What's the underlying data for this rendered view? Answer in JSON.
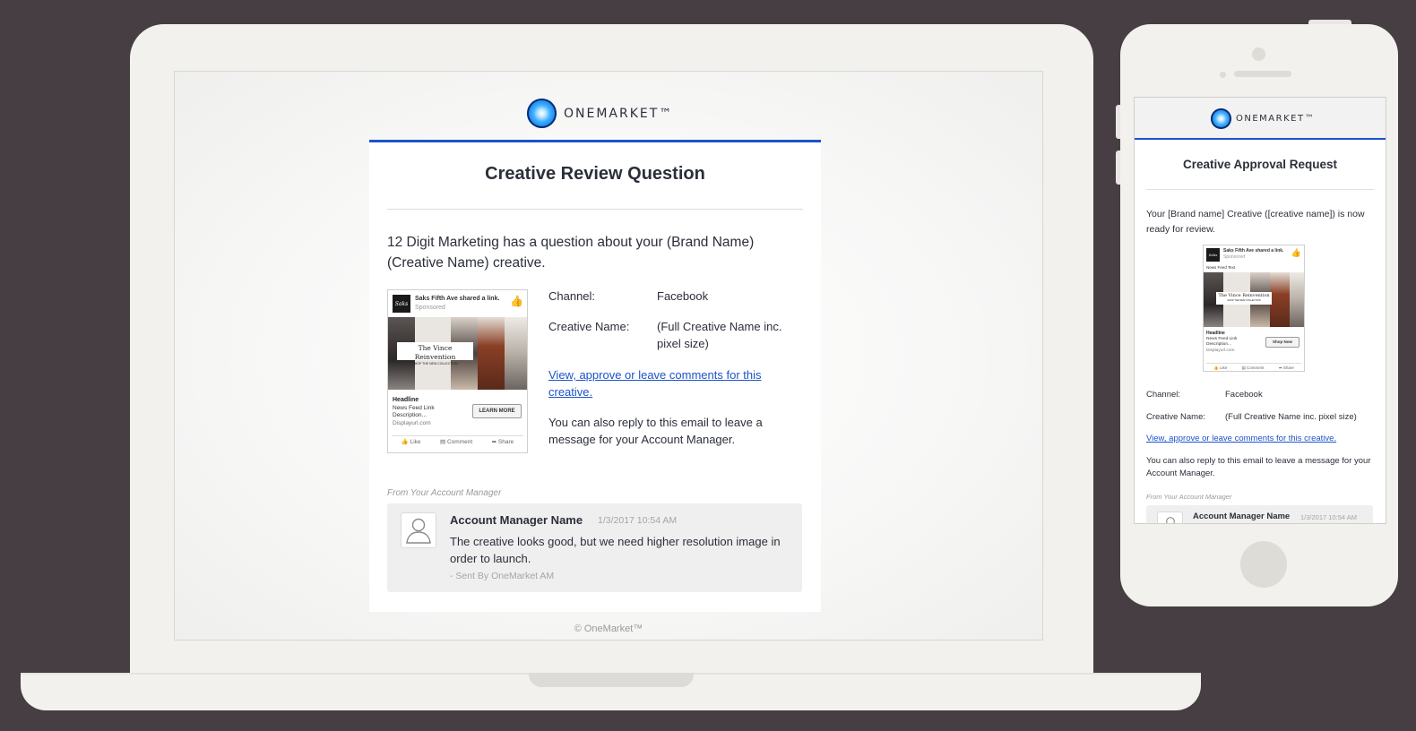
{
  "colors": {
    "background": "#463e42",
    "device": "#f2f1ed",
    "accent": "#1d53c8",
    "link": "#1d53c8",
    "text": "#2b2f3a",
    "muted": "#a5a5a5"
  },
  "brand": {
    "logo_text": "ONEMARKET™",
    "logo_icon": "onemarket-logo-icon"
  },
  "laptop_email": {
    "title": "Creative Review Question",
    "intro": "12 Digit Marketing has a question about your (Brand Name) (Creative Name) creative.",
    "details": [
      {
        "label": "Channel:",
        "value": "Facebook"
      },
      {
        "label": "Creative Name:",
        "value": "(Full Creative Name inc. pixel size)"
      }
    ],
    "review_link": "View, approve or leave comments for this creative.",
    "reply_note": "You can also reply to this email to leave a message for your Account Manager.",
    "from_label": "From Your Account Manager",
    "message": {
      "author": "Account Manager Name",
      "timestamp": "1/3/2017 10:54 AM",
      "body": "The creative looks good, but we need higher resolution image in order to launch.",
      "signature": "- Sent By OneMarket AM"
    },
    "footer": "© OneMarket™",
    "ad_preview": {
      "brand_mark": "Saks Fifth Avenue",
      "shared_text": "Saks Fifth Ave shared a link.",
      "sponsored": "Sponsored",
      "banner_title": "The Vince Reinvention",
      "banner_sub": "SHOP THE NEW COLLECTION",
      "headline": "Headline",
      "description": "News Feed Link Description...",
      "url": "Displayurl.com",
      "cta": "LEARN MORE",
      "actions": [
        "Like",
        "Comment",
        "Share"
      ]
    }
  },
  "phone_email": {
    "title": "Creative Approval Request",
    "intro": "Your [Brand name] Creative ([creative name]) is now ready for review.",
    "details": [
      {
        "label": "Channel:",
        "value": "Facebook"
      },
      {
        "label": "Creative Name:",
        "value": "(Full Creative Name inc. pixel size)"
      }
    ],
    "review_link": "View, approve or leave comments for this creative.",
    "reply_note": "You can also reply to this email to leave a message for your Account Manager.",
    "from_label": "From Your Account Manager",
    "message": {
      "author": "Account Manager Name",
      "timestamp": "1/3/2017 10:54 AM"
    },
    "ad_preview": {
      "brand_mark": "Saks Fifth Avenue",
      "shared_text": "Saks Fifth Ave shared a link.",
      "sponsored": "Sponsored",
      "news_feed_text": "News Feed Text",
      "banner_title": "The Vince Reinvention",
      "banner_sub": "SHOP THE NEW COLLECTION",
      "headline": "Headline",
      "description": "News Feed Link Description...",
      "url": "Displayurl.com",
      "cta": "Shop Now",
      "actions": [
        "Like",
        "Comment",
        "Share"
      ]
    }
  }
}
